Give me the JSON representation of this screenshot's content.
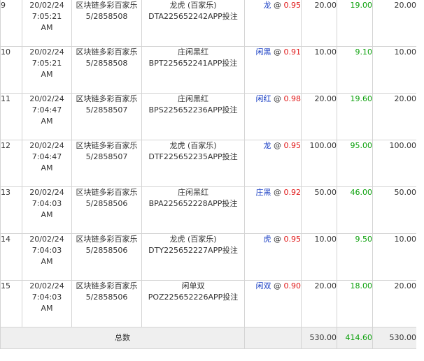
{
  "rows": [
    {
      "idx": "9",
      "date": "20/02/24",
      "time": "7:05:21",
      "ampm": "AM",
      "game": "区块链多彩百家乐",
      "round": "5/2858508",
      "bet_type": "龙虎 (百家乐)",
      "bet_id": "DTA225652242APP投注",
      "selection": "龙",
      "at": "@",
      "odds": "0.95",
      "amount": "20.00",
      "payout": "19.00",
      "valid": "20.00"
    },
    {
      "idx": "10",
      "date": "20/02/24",
      "time": "7:05:21",
      "ampm": "AM",
      "game": "区块链多彩百家乐",
      "round": "5/2858508",
      "bet_type": "庄闲黑红",
      "bet_id": "BPT225652241APP投注",
      "selection": "闲黑",
      "at": "@",
      "odds": "0.91",
      "amount": "10.00",
      "payout": "9.10",
      "valid": "10.00"
    },
    {
      "idx": "11",
      "date": "20/02/24",
      "time": "7:04:47",
      "ampm": "AM",
      "game": "区块链多彩百家乐",
      "round": "5/2858507",
      "bet_type": "庄闲黑红",
      "bet_id": "BPS225652236APP投注",
      "selection": "闲红",
      "at": "@",
      "odds": "0.98",
      "amount": "20.00",
      "payout": "19.60",
      "valid": "20.00"
    },
    {
      "idx": "12",
      "date": "20/02/24",
      "time": "7:04:47",
      "ampm": "AM",
      "game": "区块链多彩百家乐",
      "round": "5/2858507",
      "bet_type": "龙虎 (百家乐)",
      "bet_id": "DTF225652235APP投注",
      "selection": "龙",
      "at": "@",
      "odds": "0.95",
      "amount": "100.00",
      "payout": "95.00",
      "valid": "100.00"
    },
    {
      "idx": "13",
      "date": "20/02/24",
      "time": "7:04:03",
      "ampm": "AM",
      "game": "区块链多彩百家乐",
      "round": "5/2858506",
      "bet_type": "庄闲黑红",
      "bet_id": "BPA225652228APP投注",
      "selection": "庄黑",
      "at": "@",
      "odds": "0.92",
      "amount": "50.00",
      "payout": "46.00",
      "valid": "50.00"
    },
    {
      "idx": "14",
      "date": "20/02/24",
      "time": "7:04:03",
      "ampm": "AM",
      "game": "区块链多彩百家乐",
      "round": "5/2858506",
      "bet_type": "龙虎 (百家乐)",
      "bet_id": "DTY225652227APP投注",
      "selection": "虎",
      "at": "@",
      "odds": "0.95",
      "amount": "10.00",
      "payout": "9.50",
      "valid": "10.00"
    },
    {
      "idx": "15",
      "date": "20/02/24",
      "time": "7:04:03",
      "ampm": "AM",
      "game": "区块链多彩百家乐",
      "round": "5/2858506",
      "bet_type": "闲单双",
      "bet_id": "POZ225652226APP投注",
      "selection": "闲双",
      "at": "@",
      "odds": "0.90",
      "amount": "20.00",
      "payout": "18.00",
      "valid": "20.00"
    }
  ],
  "totals": {
    "label": "总数",
    "amount": "530.00",
    "payout": "414.60",
    "valid": "530.00"
  },
  "colors": {
    "selection": "#1a3fc4",
    "odds": "#e01515",
    "payout": "#0aa00a",
    "border": "#d4d4d4",
    "total_bg": "#efefef"
  }
}
